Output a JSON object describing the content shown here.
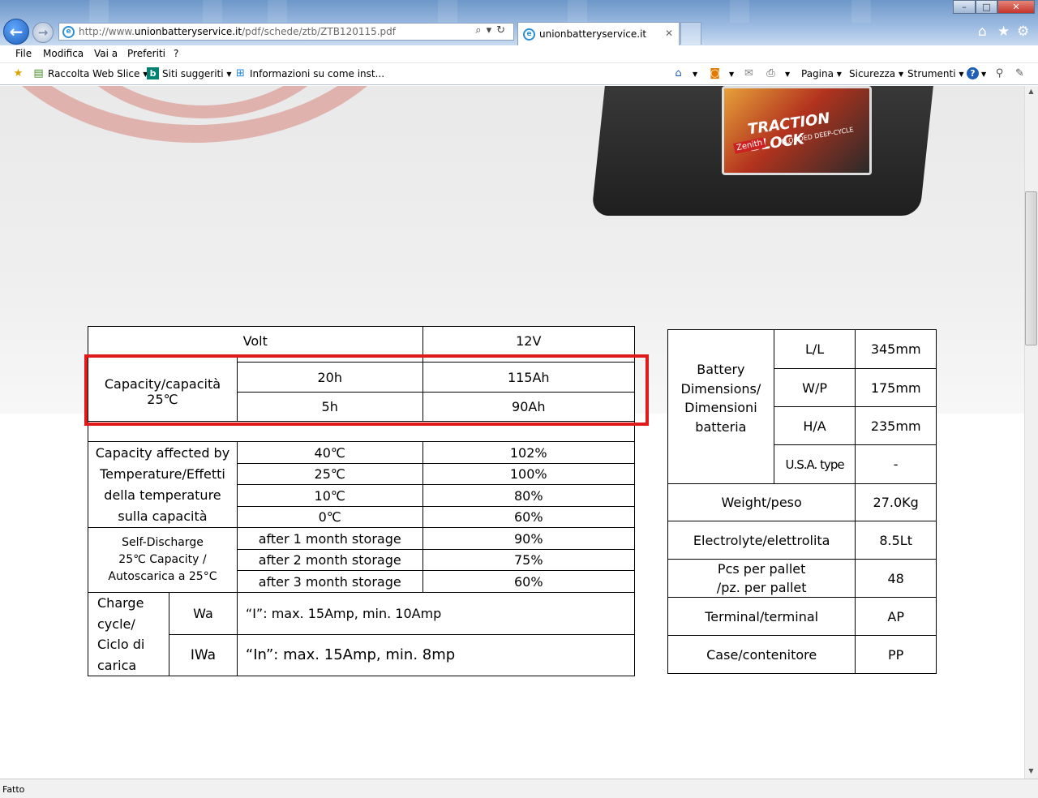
{
  "window": {
    "minimize": "–",
    "maximize": "□",
    "close": "✕"
  },
  "address": {
    "url_prefix": "http://www.",
    "url_domain": "unionbatteryservice.it",
    "url_path": "/pdf/schede/ztb/ZTB120115.pdf"
  },
  "tab": {
    "title": "unionbatteryservice.it",
    "close": "✕"
  },
  "menu": [
    "File",
    "Modifica",
    "Vai a",
    "Preferiti",
    "?"
  ],
  "favorites": {
    "web_slice": "Raccolta Web Slice",
    "suggested": "Siti suggeriti",
    "info": "Informazioni su come inst..."
  },
  "cmdbar": {
    "page": "Pagina",
    "security": "Sicurezza",
    "tools": "Strumenti"
  },
  "battery_label": {
    "brand": "Zenith",
    "name": "TRACTION BLOCK",
    "sub": "FLOODED DEEP-CYCLE"
  },
  "spec": {
    "volt_label": "Volt",
    "volt_value": "12V",
    "capacity_label": "Capacity/capacità",
    "capacity_temp": "25℃",
    "cap_rows": [
      {
        "h": "20h",
        "v": "115Ah"
      },
      {
        "h": "5h",
        "v": "90Ah"
      }
    ],
    "temp_label": [
      "Capacity affected by",
      "Temperature/Effetti",
      "della temperature",
      "sulla capacità"
    ],
    "temp_rows": [
      {
        "t": "40℃",
        "v": "102%"
      },
      {
        "t": "25℃",
        "v": "100%"
      },
      {
        "t": "10℃",
        "v": "80%"
      },
      {
        "t": "0℃",
        "v": "60%"
      }
    ],
    "sd_label": [
      "Self-Discharge",
      "25℃ Capacity /",
      "Autoscarica a 25°C"
    ],
    "sd_rows": [
      {
        "t": "after 1 month storage",
        "v": "90%"
      },
      {
        "t": "after 2 month storage",
        "v": "75%"
      },
      {
        "t": "after 3 month storage",
        "v": "60%"
      }
    ],
    "charge_label": [
      "Charge",
      "cycle/",
      "Ciclo di",
      "carica"
    ],
    "charge_rows": [
      {
        "k": "Wa",
        "v": "“I”: max. 15Amp, min.  10Amp"
      },
      {
        "k": "IWa",
        "v": "“In”: max. 15Amp, min. 8mp"
      }
    ]
  },
  "dims": {
    "label": [
      "Battery",
      "Dimensions/",
      "Dimensioni",
      "batteria"
    ],
    "rows": [
      {
        "k": "L/L",
        "v": "345mm"
      },
      {
        "k": "W/P",
        "v": "175mm"
      },
      {
        "k": "H/A",
        "v": "235mm"
      },
      {
        "k": "U.S.A. type",
        "v": "-"
      }
    ],
    "other": [
      {
        "k": "Weight/peso",
        "v": "27.0Kg"
      },
      {
        "k": "Electrolyte/elettrolita",
        "v": "8.5Lt"
      },
      {
        "k": "Pcs per pallet\n/pz. per pallet",
        "v": "48"
      },
      {
        "k": "Terminal/terminal",
        "v": "AP"
      },
      {
        "k": "Case/contenitore",
        "v": "PP"
      }
    ]
  },
  "status": "Fatto",
  "colors": {
    "highlight": "#e01919",
    "ie_blue": "#2b8fd6"
  }
}
